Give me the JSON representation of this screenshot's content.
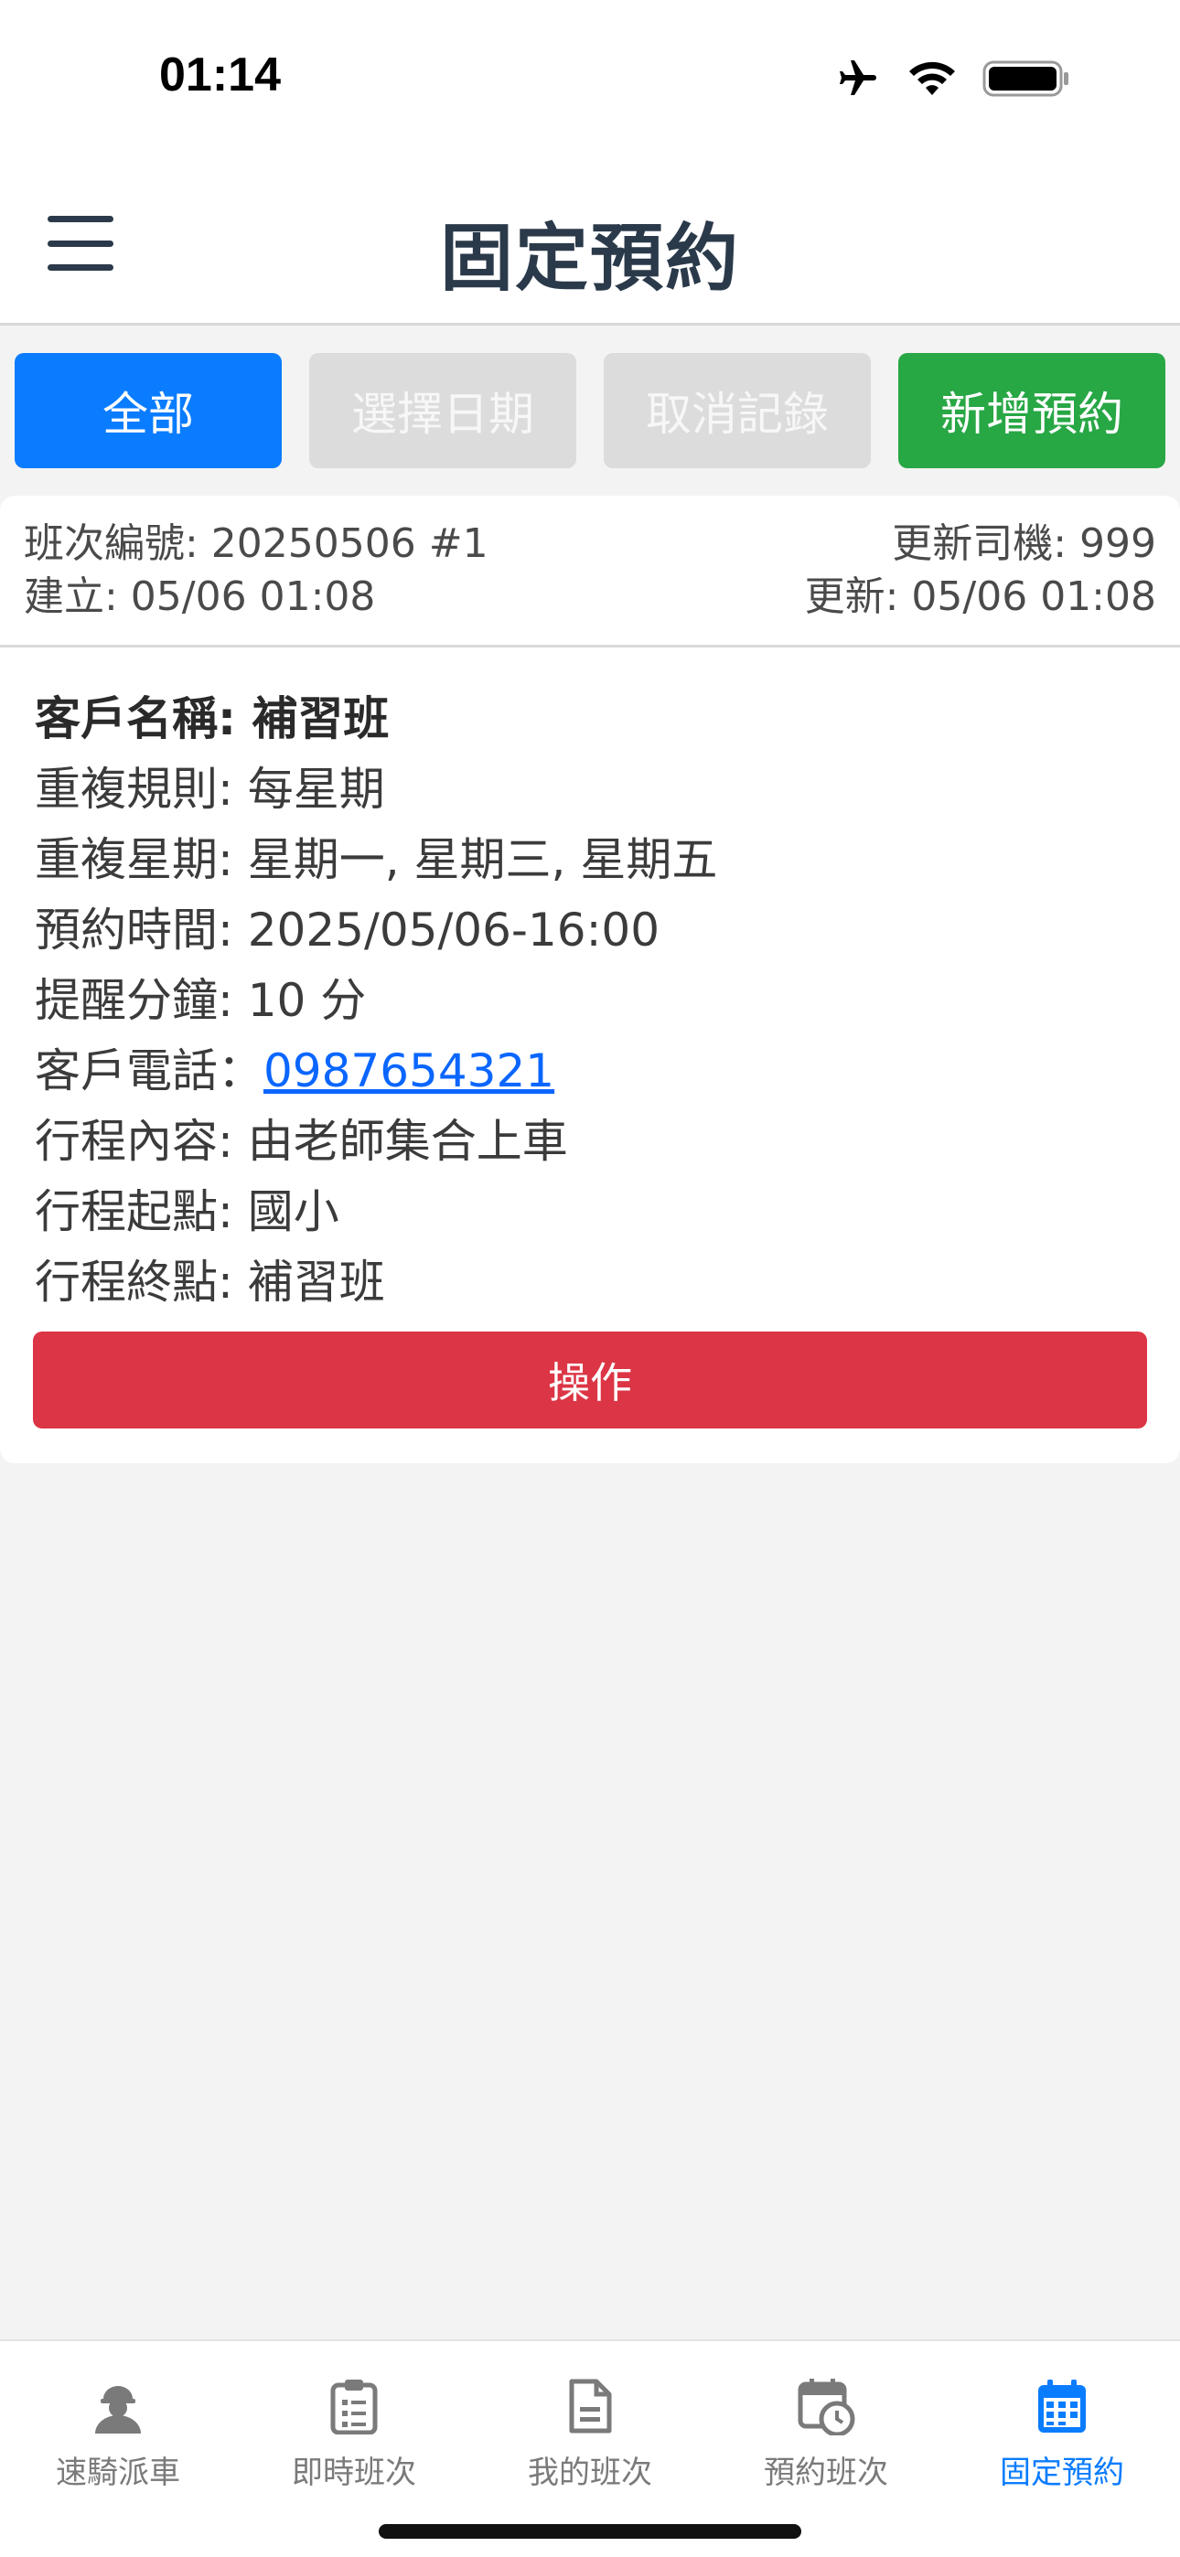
{
  "status_bar": {
    "time": "01:14",
    "icons": [
      "airplane-icon",
      "wifi-icon",
      "battery-icon"
    ]
  },
  "header": {
    "title": "固定預約",
    "menu_icon": "hamburger-menu-icon"
  },
  "filters": {
    "all": "全部",
    "select_date": "選擇日期",
    "cancel_records": "取消記錄",
    "add_booking": "新增預約"
  },
  "card": {
    "trip_no": "班次編號: 20250506 #1",
    "created": "建立: 05/06 01:08",
    "driver": "更新司機: 999",
    "updated": "更新: 05/06 01:08",
    "customer_name": "客戶名稱: 補習班",
    "repeat_rule": "重複規則: 每星期",
    "repeat_days": "重複星期: 星期一, 星期三, 星期五",
    "booking_time": "預約時間: 2025/05/06-16:00",
    "reminder": "提醒分鐘: 10 分",
    "phone_label": "客戶電話：",
    "phone": "0987654321",
    "content": "行程內容: 由老師集合上車",
    "start": "行程起點: 國小",
    "end": "行程終點: 補習班",
    "action": "操作"
  },
  "tabs": [
    {
      "label": "速騎派車",
      "icon": "driver-icon"
    },
    {
      "label": "即時班次",
      "icon": "clipboard-list-icon"
    },
    {
      "label": "我的班次",
      "icon": "document-icon"
    },
    {
      "label": "預約班次",
      "icon": "calendar-clock-icon"
    },
    {
      "label": "固定預約",
      "icon": "calendar-grid-icon",
      "active": true
    }
  ],
  "colors": {
    "primary": "#0a7cff",
    "success": "#28a745",
    "danger": "#dc3545",
    "disabled": "#dcdcdc",
    "title": "#2b3a4a"
  }
}
